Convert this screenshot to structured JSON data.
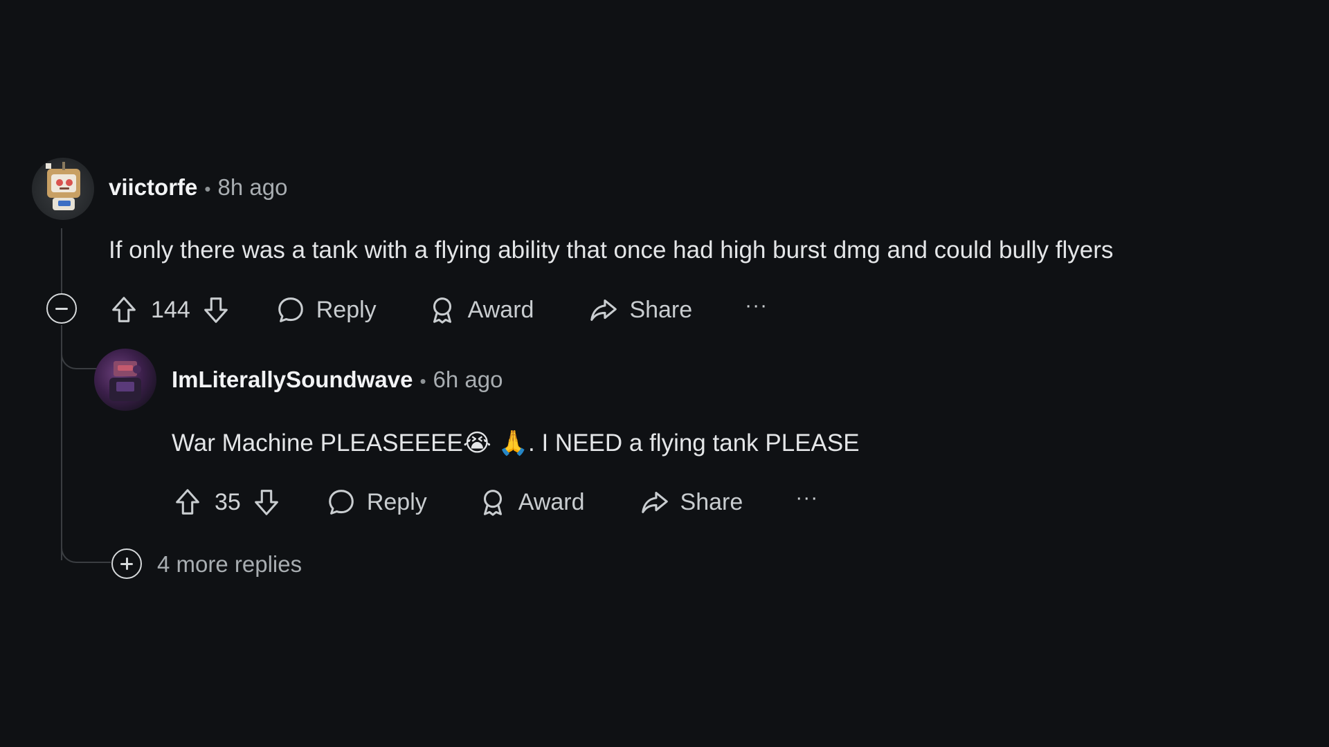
{
  "comment": {
    "username": "viictorfe",
    "separator": "•",
    "time": "8h ago",
    "text": "If only there was a tank with a flying ability that once had high burst dmg and could bully flyers",
    "votes": "144",
    "reply_label": "Reply",
    "award_label": "Award",
    "share_label": "Share",
    "more_label": "···"
  },
  "reply": {
    "username": "ImLiterallySoundwave",
    "separator": "•",
    "time": "6h ago",
    "text": "War Machine PLEASEEEE😭 🙏. I NEED a flying tank PLEASE",
    "votes": "35",
    "reply_label": "Reply",
    "award_label": "Award",
    "share_label": "Share",
    "more_label": "···"
  },
  "more_replies": "4 more replies",
  "colors": {
    "background": "#0f1114",
    "text": "#d7dadc",
    "muted": "#a8adb1",
    "thread_line": "#3a3d41"
  }
}
